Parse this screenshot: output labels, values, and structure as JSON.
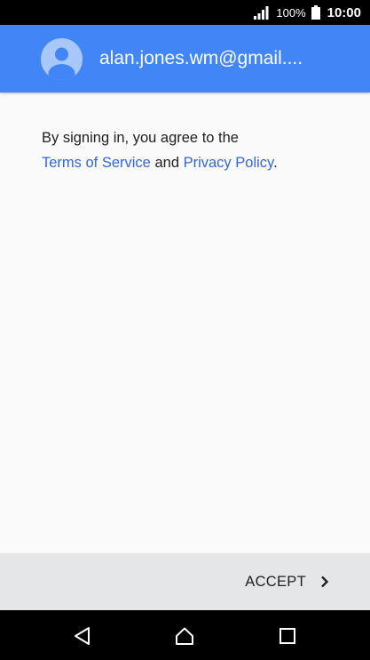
{
  "status_bar": {
    "battery_percent": "100%",
    "time": "10:00",
    "icons": [
      "signal-icon",
      "battery-icon"
    ]
  },
  "account": {
    "email": "alan.jones.wm@gmail....",
    "avatar_icon": "default-avatar-icon"
  },
  "consent": {
    "prefix": "By signing in, you agree to the",
    "terms_link": "Terms of Service",
    "conjunction": "and",
    "privacy_link": "Privacy Policy",
    "suffix": "."
  },
  "footer": {
    "accept_label": "ACCEPT",
    "accept_icon": "chevron-right-icon"
  },
  "nav_bar": {
    "icons": [
      "back-icon",
      "home-icon",
      "recents-icon"
    ]
  },
  "colors": {
    "header_background": "#4285f4",
    "link": "#3367d6",
    "footer_background": "#e4e6e8",
    "page_background": "#fafafa"
  }
}
